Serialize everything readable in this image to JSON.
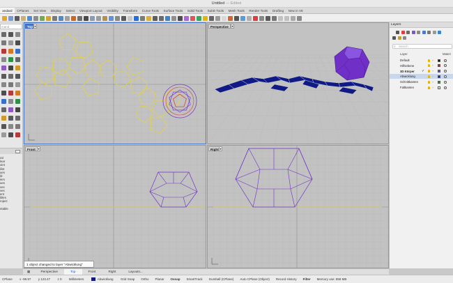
{
  "window": {
    "title": "Untitled",
    "edited": "— Edited"
  },
  "tabs": [
    "andard",
    "CPlanes",
    "Set View",
    "Display",
    "Select",
    "Viewport Layout",
    "Visibility",
    "Transform",
    "Curve Tools",
    "Surface Tools",
    "Solid Tools",
    "SubD Tools",
    "Mesh Tools",
    "Render Tools",
    "Drafting",
    "New in V8"
  ],
  "active_tab": 0,
  "command_placeholder": "mand",
  "left_list": [
    "ral",
    "lear",
    "oint",
    "ilist",
    "ues",
    "ld",
    "iers",
    "ues",
    "ves",
    "ves",
    "ent",
    "ibles",
    "roject",
    "",
    "ntable"
  ],
  "viewports": {
    "top": {
      "label": "Top"
    },
    "perspective": {
      "label": "Perspective"
    },
    "front": {
      "label": "Front"
    },
    "right": {
      "label": "Right"
    }
  },
  "layers": {
    "title": "Layers",
    "search_placeholder": "Search",
    "col_layer": "Layer",
    "col_material": "Materi",
    "rows": [
      {
        "name": "Default",
        "color": "#111111",
        "current": false,
        "selected": false
      },
      {
        "name": "Hilfsebene",
        "color": "#d42020",
        "current": false,
        "selected": false
      },
      {
        "name": "3D Körper",
        "color": "#7a3cc7",
        "current": true,
        "selected": false
      },
      {
        "name": "Abwicklung",
        "color": "#1428c8",
        "current": false,
        "selected": true
      },
      {
        "name": "Schnittkanten",
        "color": "#2a9a2a",
        "current": false,
        "selected": false
      },
      {
        "name": "Faltkanten",
        "color": "#ffffff",
        "current": false,
        "selected": false
      }
    ]
  },
  "viewport_tabs": [
    "Perspective",
    "Top",
    "Front",
    "Right",
    "Layouts..."
  ],
  "active_vptab": 1,
  "notification": "1 object changed to layer \"Abwicklung\"",
  "status": {
    "cplane": "CPlane",
    "x": "x -99.97",
    "y": "y 123.47",
    "z": "z 0",
    "units": "Millimeters",
    "layer": "Abwicklung",
    "items": [
      "Grid Snap",
      "Ortho",
      "Planar",
      "Osnap",
      "SmartTrack",
      "Gumball (CPlane)",
      "Auto CPlane (Object)",
      "Record History",
      "Filter",
      "Memory use: 858 MB"
    ],
    "bold_items": [
      "Osnap",
      "Filter"
    ]
  },
  "colors": {
    "unfold_line": "#e2d24a",
    "solid": "#7030c8",
    "mesh_blue": "#101a86",
    "selection": "#d0483a",
    "active_vp": "#4a79c9"
  }
}
